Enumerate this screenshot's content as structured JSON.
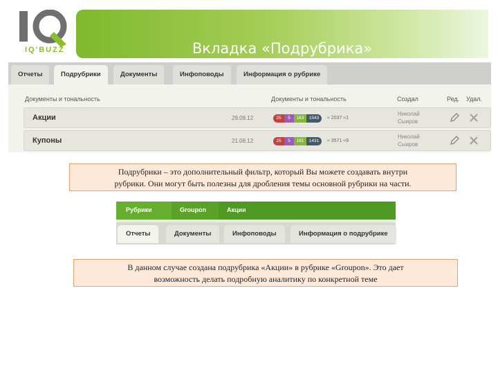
{
  "logo": {
    "brand_text": "IQ'BUZZ"
  },
  "slide": {
    "title": "Вкладка «Подрубрика»"
  },
  "screen1": {
    "tabs": [
      {
        "label": "Отчеты"
      },
      {
        "label": "Подрубрики"
      },
      {
        "label": "Документы"
      },
      {
        "label": "Инфоповоды"
      },
      {
        "label": "Информация о рубрике"
      }
    ],
    "active_tab": "Подрубрики",
    "headers": {
      "doc_tone_1": "Документы и тональность",
      "doc_tone_2": "Документы и тональность",
      "created": "Создал",
      "edit": "Ред.",
      "delete": "Удал."
    },
    "rows": [
      {
        "name": "Акции",
        "date": "29.08.12",
        "tone": [
          "25",
          "5",
          "163",
          "1543"
        ],
        "stats": "≈ 2037  ≈1",
        "author_first": "Николай",
        "author_last": "Сыиров"
      },
      {
        "name": "Купоны",
        "date": "21.08.12",
        "tone": [
          "25",
          "5",
          "181",
          "1431"
        ],
        "stats": "≈ 3571  ≈9",
        "author_first": "Николай",
        "author_last": "Сыиров"
      }
    ],
    "tone_colors": [
      "#c2423f",
      "#9a5cb5",
      "#88b53c",
      "#45586a"
    ]
  },
  "note1": {
    "line1": "Подрубрики – это дополнительный фильтр, который Вы можете создавать внутри",
    "line2": "рубрики. Они могут быть полезны для дробления темы основной рубрики на части."
  },
  "screen2": {
    "breadcrumb": [
      "Рубрики",
      "Groupon",
      "Акции"
    ],
    "tabs": [
      {
        "label": "Отчеты"
      },
      {
        "label": "Документы"
      },
      {
        "label": "Инфоповоды"
      },
      {
        "label": "Информация о подрубрике"
      }
    ],
    "active_tab": "Отчеты"
  },
  "note2": {
    "line1": "В данном случае создана подрубрика «Акции» в рубрике «Groupon». Это дает",
    "line2": "возможность делать подробную аналитику по конкретной теме"
  }
}
